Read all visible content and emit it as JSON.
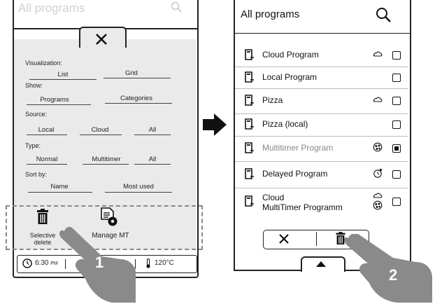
{
  "left": {
    "header_title": "All programs",
    "filters": {
      "visualization_label": "Visualization:",
      "visualization_options": [
        "List",
        "Grid"
      ],
      "show_label": "Show:",
      "show_options": [
        "Programs",
        "Categories"
      ],
      "source_label": "Source:",
      "source_options": [
        "Local",
        "Cloud",
        "All"
      ],
      "type_label": "Type:",
      "type_options": [
        "Normal",
        "Multitimer",
        "All"
      ],
      "sort_label": "Sort by:",
      "sort_options": [
        "Name",
        "Most used"
      ]
    },
    "actions": {
      "selective_delete": "Selective delete",
      "selective_delete_line1": "Selective",
      "selective_delete_line2": "delete",
      "manage_mt": "Manage MT"
    },
    "status": {
      "time": "6:30",
      "ampm": "PM",
      "temperature": "120°C"
    }
  },
  "right": {
    "title": "All programs",
    "programs": [
      {
        "name": "Cloud Program",
        "icon": "cloud-icon",
        "checked": false,
        "muted": false
      },
      {
        "name": "Local Program",
        "icon": "",
        "checked": false,
        "muted": false
      },
      {
        "name": "Pizza",
        "icon": "cloud-icon",
        "checked": false,
        "muted": false
      },
      {
        "name": "Pizza (local)",
        "icon": "",
        "checked": false,
        "muted": false
      },
      {
        "name": "Multitimer Program",
        "icon": "multitimer-icon",
        "checked": true,
        "muted": true
      },
      {
        "name": "Delayed Program",
        "icon": "delayed-icon",
        "checked": false,
        "muted": false
      },
      {
        "name": "Cloud",
        "name2": "MultiTimer Programm",
        "icon": "cloud-multitimer-icon",
        "checked": false,
        "muted": false
      }
    ]
  },
  "badges": {
    "step1": "1",
    "step2": "2"
  },
  "colors": {
    "panel": "#eaeaea",
    "hand": "#8a8a8a",
    "line": "#222222"
  }
}
